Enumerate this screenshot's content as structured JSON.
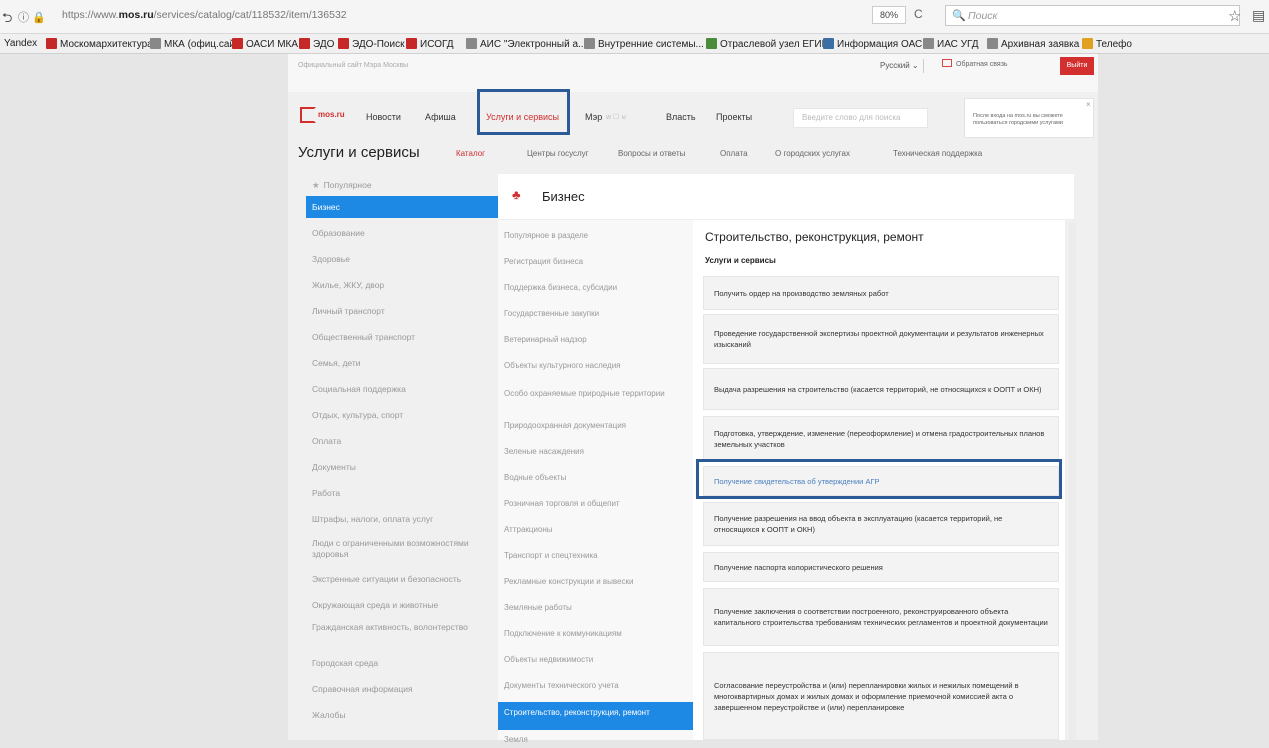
{
  "browser": {
    "url_prefix": "https://www.",
    "url_domain": "mos.ru",
    "url_path": "/services/catalog/cat/118532/item/136532",
    "zoom": "80%",
    "search_placeholder": "Поиск"
  },
  "bookmarks": [
    {
      "label": "Yandex",
      "color": ""
    },
    {
      "label": "Москомархитектура",
      "color": "#c62828"
    },
    {
      "label": "МКА (офиц.сайт)",
      "color": "#888888"
    },
    {
      "label": "ОАСИ МКА",
      "color": "#c62828"
    },
    {
      "label": "ЭДО",
      "color": "#c62828"
    },
    {
      "label": "ЭДО-Поиск",
      "color": "#c62828"
    },
    {
      "label": "ИСОГД",
      "color": "#c62828"
    },
    {
      "label": "АИС \"Электронный а...",
      "color": "#888888"
    },
    {
      "label": "Внутренние системы...",
      "color": "#888888"
    },
    {
      "label": "Отраслевой узел ЕГИП",
      "color": "#4a8c3a"
    },
    {
      "label": "Информация ОАСИ",
      "color": "#3a6ea5"
    },
    {
      "label": "ИАС УГД",
      "color": "#888888"
    },
    {
      "label": "Архивная заявка",
      "color": "#888888"
    },
    {
      "label": "Телефо",
      "color": "#e0a020"
    }
  ],
  "top": {
    "official": "Официальный сайт Мэра Москвы",
    "lang": "Русский",
    "feedback": "Обратная связь",
    "logout": "Выйти"
  },
  "nav": {
    "logo": "mos.ru",
    "items": [
      "Новости",
      "Афиша",
      "Услуги и сервисы",
      "Мэр",
      "Власть",
      "Проекты"
    ],
    "active_index": 2,
    "mayor_social": "w ☐ ⊌",
    "search_placeholder": "Введите слово для поиска",
    "tip": "После входа на mos.ru вы сможете пользоваться городскими услугами",
    "tip_close": "×"
  },
  "section": {
    "title": "Услуги и сервисы",
    "tabs": [
      "Каталог",
      "Центры госуслуг",
      "Вопросы и ответы",
      "Оплата",
      "О городских услугах",
      "Техническая поддержка"
    ],
    "active_tab": 0
  },
  "left_nav": {
    "items": [
      "Популярное",
      "Бизнес",
      "Образование",
      "Здоровье",
      "Жилье, ЖКУ, двор",
      "Личный транспорт",
      "Общественный транспорт",
      "Семья, дети",
      "Социальная поддержка",
      "Отдых, культура, спорт",
      "Оплата",
      "Документы",
      "Работа",
      "Штрафы, налоги, оплата услуг",
      "Люди с ограниченными возможностями здоровья",
      "Экстренные ситуации и безопасность",
      "Окружающая среда и животные",
      "Гражданская активность, волонтерство",
      "Городская среда",
      "Справочная информация",
      "Жалобы"
    ],
    "active_index": 1
  },
  "business": {
    "title": "Бизнес",
    "subcategories": [
      "Популярное в разделе",
      "Регистрация бизнеса",
      "Поддержка бизнеса, субсидии",
      "Государственные закупки",
      "Ветеринарный надзор",
      "Объекты культурного наследия",
      "Особо охраняемые природные территории",
      "Природоохранная документация",
      "Зеленые насаждения",
      "Водные объекты",
      "Розничная торговля и общепит",
      "Аттракционы",
      "Транспорт и спецтехника",
      "Рекламные конструкции и вывески",
      "Земляные работы",
      "Подключение к коммуникациям",
      "Объекты недвижимости",
      "Документы технического учета",
      "Строительство, реконструкция, ремонт",
      "Земля"
    ],
    "active_sub": 18
  },
  "content": {
    "heading": "Строительство, реконструкция, ремонт",
    "subheading": "Услуги и сервисы",
    "services": [
      "Получить ордер на производство земляных работ",
      "Проведение государственной экспертизы проектной документации и результатов инженерных изысканий",
      "Выдача разрешения на строительство (касается территорий, не относящихся к ООПТ и ОКН)",
      "Подготовка, утверждение, изменение (переоформление) и отмена градостроительных планов земельных участков",
      "Получение свидетельства об утверждении АГР",
      "Получение разрешения на ввод объекта в эксплуатацию (касается территорий, не относящихся к ООПТ и ОКН)",
      "Получение паспорта колористического решения",
      "Получение заключения о соответствии построенного, реконструированного объекта капитального строительства требованиям технических регламентов и проектной документации",
      "Согласование переустройства и (или) перепланировки жилых и нежилых помещений в многоквартирных домах и жилых домах и оформление приемочной комиссией акта о завершенном переустройстве и (или) перепланировке"
    ],
    "highlighted_index": 4
  }
}
